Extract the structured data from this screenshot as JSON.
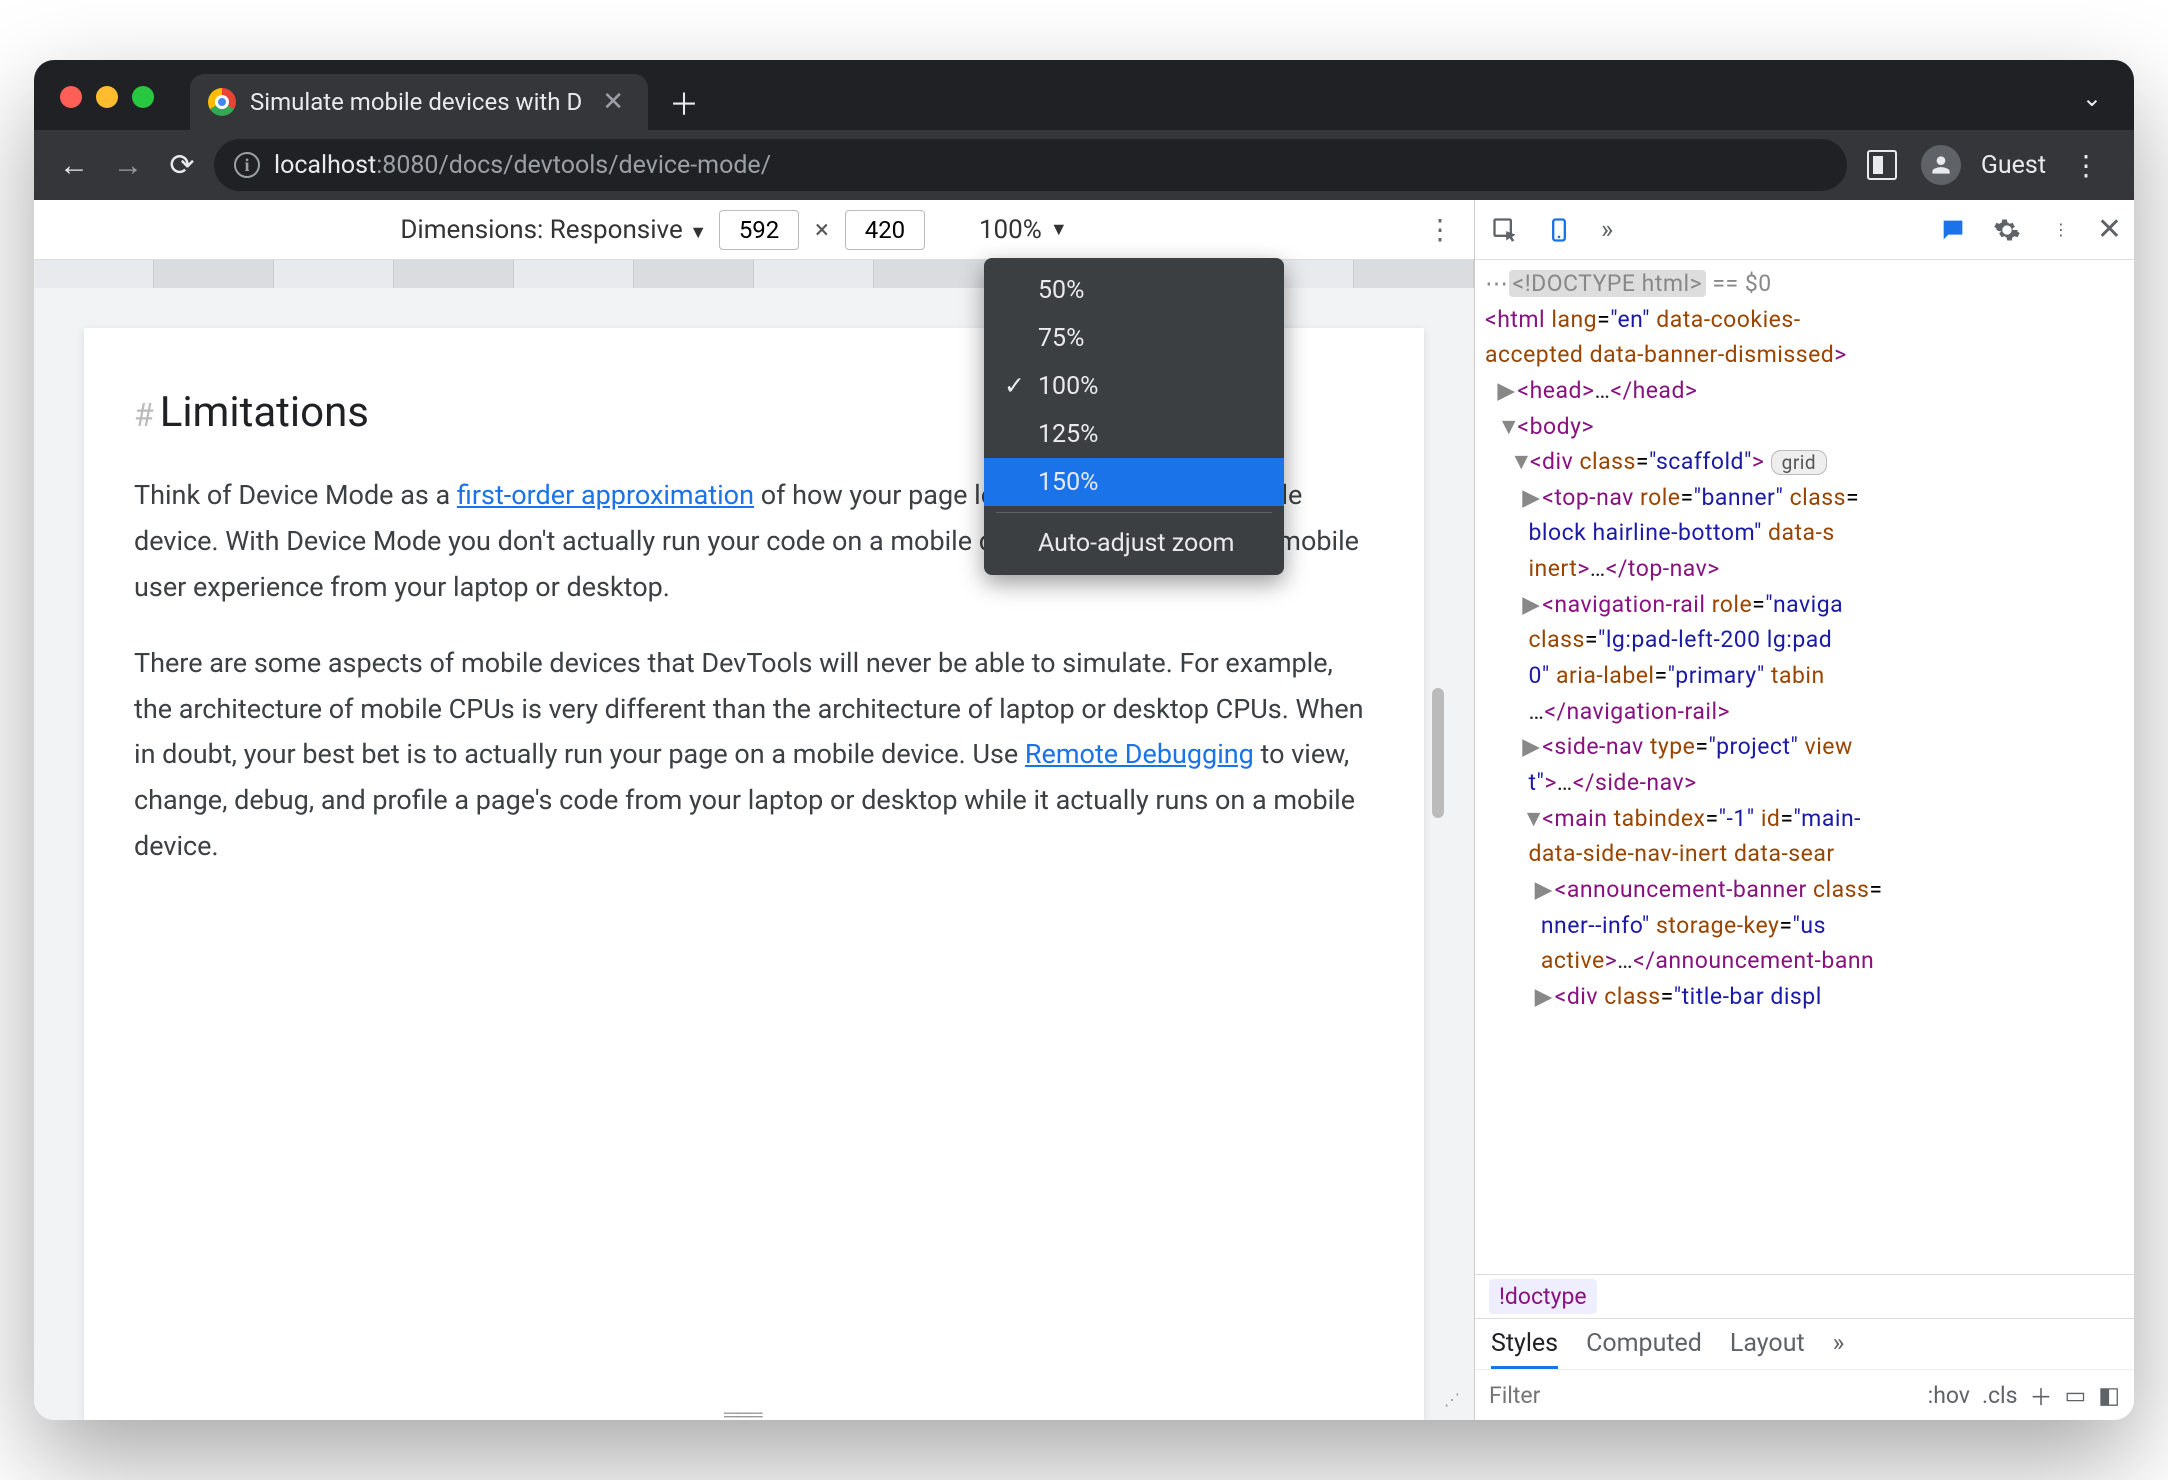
{
  "browser": {
    "tab_title": "Simulate mobile devices with D",
    "url_host": "localhost",
    "url_port": ":8080",
    "url_path": "/docs/devtools/device-mode/",
    "guest_label": "Guest"
  },
  "device_toolbar": {
    "dimensions_label": "Dimensions: Responsive",
    "width": "592",
    "height": "420",
    "zoom_label": "100%"
  },
  "zoom_menu": {
    "items": [
      "50%",
      "75%",
      "100%",
      "125%",
      "150%"
    ],
    "checked_index": 2,
    "selected_index": 4,
    "footer": "Auto-adjust zoom"
  },
  "page": {
    "heading": "Limitations",
    "p1a": "Think of Device Mode as a ",
    "p1_link": "first-order approximation",
    "p1b": " of how your page looks and feels on a mobile device. With Device Mode you don't actually run your code on a mobile device. You simulate the mobile user experience from your laptop or desktop.",
    "p2a": "There are some aspects of mobile devices that DevTools will never be able to simulate. For example, the architecture of mobile CPUs is very different than the architecture of laptop or desktop CPUs. When in doubt, your best bet is to actually run your page on a mobile device. Use ",
    "p2_link": "Remote Debugging",
    "p2b": " to view, change, debug, and profile a page's code from your laptop or desktop while it actually runs on a mobile device."
  },
  "devtools": {
    "doctype": "<!DOCTYPE html>",
    "eq0": " == $0",
    "crumb": "!doctype",
    "styles_tabs": [
      "Styles",
      "Computed",
      "Layout"
    ],
    "filter_placeholder": "Filter",
    "hov": ":hov",
    "cls": ".cls",
    "dom": {
      "html_open": "<html lang=\"en\" data-cookies-accepted data-banner-dismissed>",
      "head": "<head>…</head>",
      "body": "<body>",
      "div_scaffold_open": "<div class=\"scaffold\">",
      "grid_pill": "grid",
      "topnav_a": "<top-nav role=\"banner\" class=",
      "topnav_b": "block hairline-bottom\" data-s",
      "topnav_c": "inert>…</top-nav>",
      "navrail_a": "<navigation-rail role=\"naviga",
      "navrail_b": "class=\"lg:pad-left-200 lg:pad",
      "navrail_c": "0\" aria-label=\"primary\" tabin",
      "navrail_d": "…</navigation-rail>",
      "sidenav_a": "<side-nav type=\"project\" view",
      "sidenav_b": "t\">…</side-nav>",
      "main_a": "<main tabindex=\"-1\" id=\"main-",
      "main_b": "data-side-nav-inert data-sear",
      "ann_a": "<announcement-banner class=",
      "ann_b": "nner--info\" storage-key=\"us",
      "ann_c": "active>…</announcement-bann",
      "titlebar": "<div class=\"title-bar displ"
    }
  }
}
